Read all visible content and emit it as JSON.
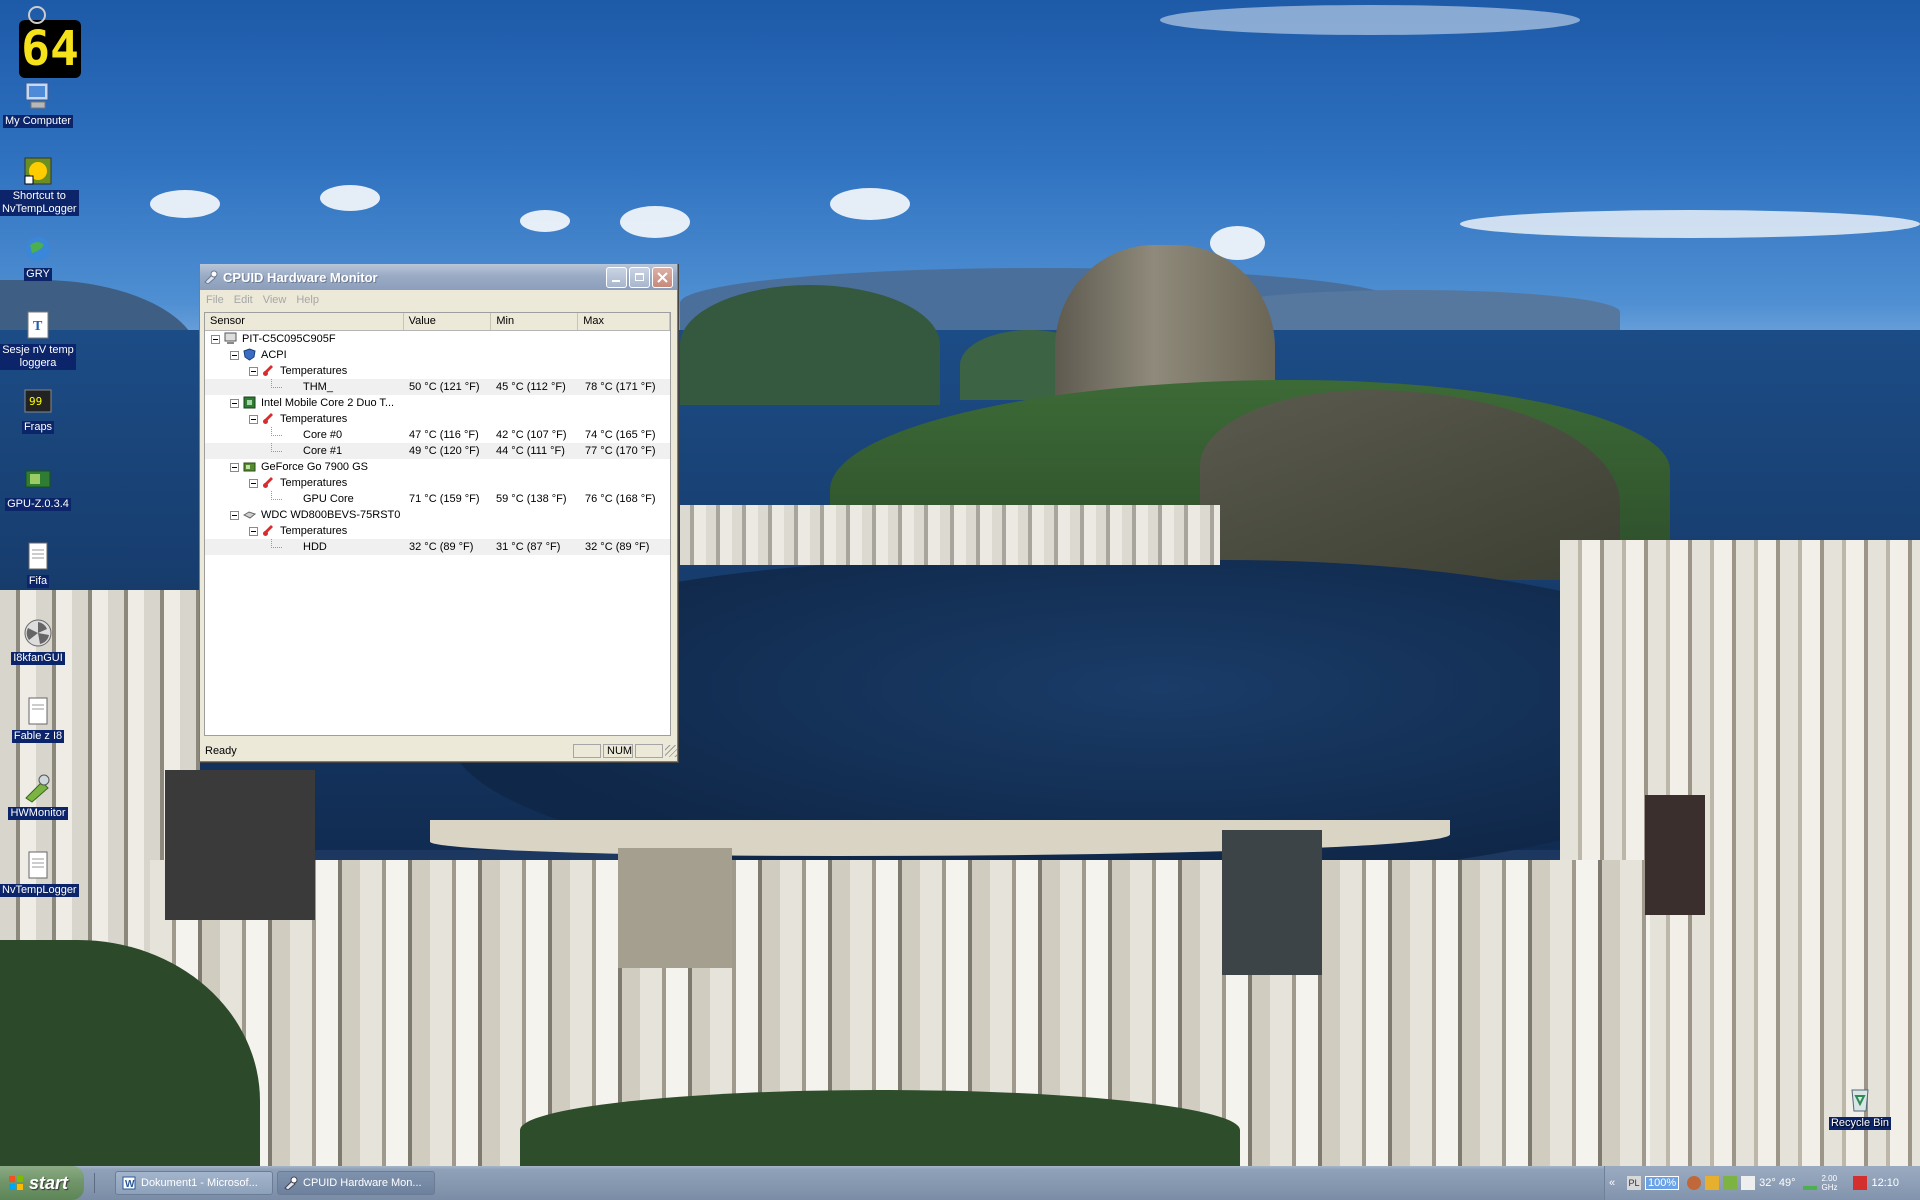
{
  "desktop": {
    "icons": [
      {
        "label": "My Computer"
      },
      {
        "label": "Shortcut to NvTempLogger"
      },
      {
        "label": "GRY"
      },
      {
        "label": "Sesje nV temp loggera"
      },
      {
        "label": "Fraps"
      },
      {
        "label": "GPU-Z.0.3.4"
      },
      {
        "label": "Fifa"
      },
      {
        "label": "I8kfanGUI"
      },
      {
        "label": "Fable z I8"
      },
      {
        "label": "HWMonitor"
      },
      {
        "label": "NvTempLogger"
      }
    ],
    "recycle_bin": "Recycle Bin",
    "cpu_widget_value": "64"
  },
  "window": {
    "title": "CPUID Hardware Monitor",
    "menu": [
      "File",
      "Edit",
      "View",
      "Help"
    ],
    "columns": [
      "Sensor",
      "Value",
      "Min",
      "Max"
    ],
    "rows": [
      {
        "level": 0,
        "label": "PIT-C5C095C905F",
        "icon": "computer-icon",
        "value": "",
        "min": "",
        "max": ""
      },
      {
        "level": 1,
        "label": "ACPI",
        "icon": "acpi-icon",
        "value": "",
        "min": "",
        "max": ""
      },
      {
        "level": 2,
        "label": "Temperatures",
        "icon": "thermometer-icon",
        "value": "",
        "min": "",
        "max": ""
      },
      {
        "level": 3,
        "label": "THM_",
        "icon": "",
        "value": "50 °C (121 °F)",
        "min": "45 °C (112 °F)",
        "max": "78 °C (171 °F)"
      },
      {
        "level": 1,
        "label": "Intel Mobile Core 2 Duo T...",
        "icon": "cpu-icon",
        "value": "",
        "min": "",
        "max": ""
      },
      {
        "level": 2,
        "label": "Temperatures",
        "icon": "thermometer-icon",
        "value": "",
        "min": "",
        "max": ""
      },
      {
        "level": 3,
        "label": "Core #0",
        "icon": "",
        "value": "47 °C (116 °F)",
        "min": "42 °C (107 °F)",
        "max": "74 °C (165 °F)"
      },
      {
        "level": 3,
        "label": "Core #1",
        "icon": "",
        "value": "49 °C (120 °F)",
        "min": "44 °C (111 °F)",
        "max": "77 °C (170 °F)"
      },
      {
        "level": 1,
        "label": "GeForce Go 7900 GS",
        "icon": "gpu-icon",
        "value": "",
        "min": "",
        "max": ""
      },
      {
        "level": 2,
        "label": "Temperatures",
        "icon": "thermometer-icon",
        "value": "",
        "min": "",
        "max": ""
      },
      {
        "level": 3,
        "label": "GPU Core",
        "icon": "",
        "value": "71 °C (159 °F)",
        "min": "59 °C (138 °F)",
        "max": "76 °C (168 °F)"
      },
      {
        "level": 1,
        "label": "WDC WD800BEVS-75RST0",
        "icon": "hdd-icon",
        "value": "",
        "min": "",
        "max": ""
      },
      {
        "level": 2,
        "label": "Temperatures",
        "icon": "thermometer-icon",
        "value": "",
        "min": "",
        "max": ""
      },
      {
        "level": 3,
        "label": "HDD",
        "icon": "",
        "value": "32 °C (89 °F)",
        "min": "31 °C (87 °F)",
        "max": "32 °C (89 °F)"
      }
    ],
    "status": "Ready",
    "num_indicator": "NUM"
  },
  "taskbar": {
    "start_label": "start",
    "tasks": [
      {
        "label": "Dokument1 - Microsof...",
        "active": false
      },
      {
        "label": "CPUID Hardware Mon...",
        "active": true
      }
    ],
    "tray": {
      "battery": "100%",
      "temperature": "32° 49°",
      "clock": "12:10",
      "cpu_freq": "2.00 GHz"
    }
  },
  "colors": {
    "selection_blue": "#0b246a",
    "title_gray_blue": "#9aabc4",
    "taskbar_gray_blue": "#8799b0"
  }
}
